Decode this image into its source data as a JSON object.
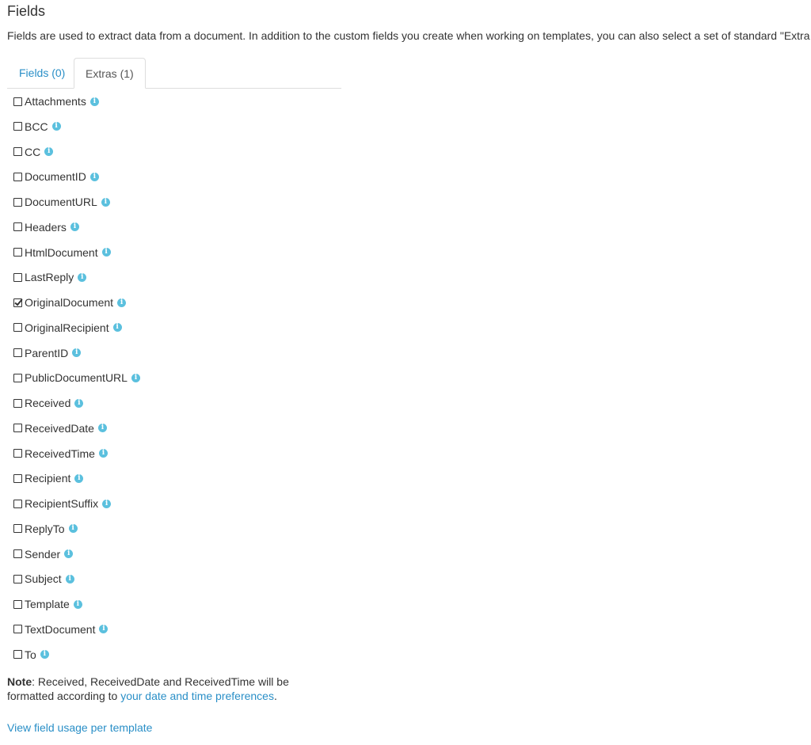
{
  "header": {
    "title": "Fields",
    "description": "Fields are used to extract data from a document. In addition to the custom fields you create when working on templates, you can also select a set of standard \"Extra fields\"."
  },
  "tabs": [
    {
      "label": "Fields (0)",
      "active": false
    },
    {
      "label": "Extras (1)",
      "active": true
    }
  ],
  "extras": [
    {
      "label": "Attachments",
      "checked": false
    },
    {
      "label": "BCC",
      "checked": false
    },
    {
      "label": "CC",
      "checked": false
    },
    {
      "label": "DocumentID",
      "checked": false
    },
    {
      "label": "DocumentURL",
      "checked": false
    },
    {
      "label": "Headers",
      "checked": false
    },
    {
      "label": "HtmlDocument",
      "checked": false
    },
    {
      "label": "LastReply",
      "checked": false
    },
    {
      "label": "OriginalDocument",
      "checked": true
    },
    {
      "label": "OriginalRecipient",
      "checked": false
    },
    {
      "label": "ParentID",
      "checked": false
    },
    {
      "label": "PublicDocumentURL",
      "checked": false
    },
    {
      "label": "Received",
      "checked": false
    },
    {
      "label": "ReceivedDate",
      "checked": false
    },
    {
      "label": "ReceivedTime",
      "checked": false
    },
    {
      "label": "Recipient",
      "checked": false
    },
    {
      "label": "RecipientSuffix",
      "checked": false
    },
    {
      "label": "ReplyTo",
      "checked": false
    },
    {
      "label": "Sender",
      "checked": false
    },
    {
      "label": "Subject",
      "checked": false
    },
    {
      "label": "Template",
      "checked": false
    },
    {
      "label": "TextDocument",
      "checked": false
    },
    {
      "label": "To",
      "checked": false
    }
  ],
  "note": {
    "bold": "Note",
    "text": ": Received, ReceivedDate and ReceivedTime will be formatted according to ",
    "link": "your date and time preferences",
    "end": "."
  },
  "usage_link": "View field usage per template",
  "colors": {
    "link": "#2a8fc7",
    "info_icon": "#5bc0de",
    "text": "#333333"
  },
  "icons": {
    "checkbox": "square-o-icon",
    "checked": "check-square-o-icon",
    "info": "info-circle-icon"
  }
}
